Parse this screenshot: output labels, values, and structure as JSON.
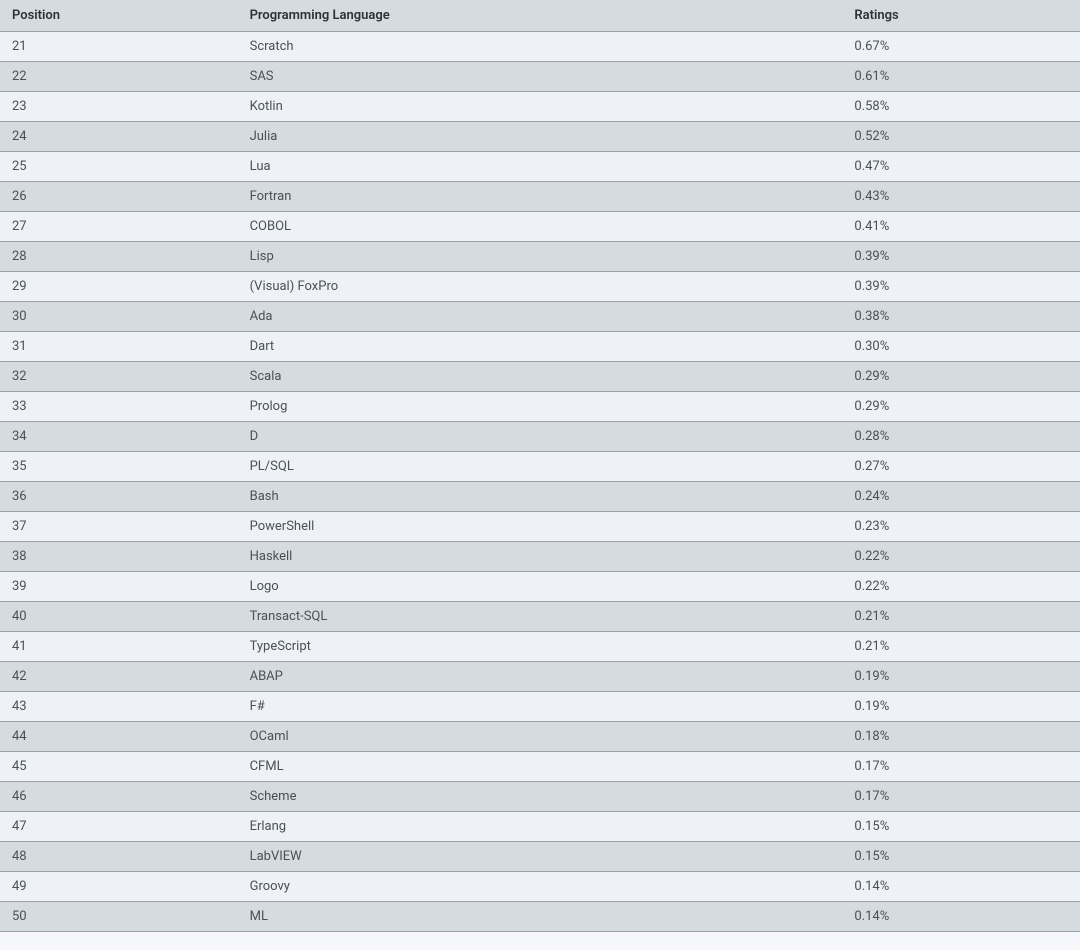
{
  "table": {
    "headers": {
      "position": "Position",
      "language": "Programming Language",
      "ratings": "Ratings"
    },
    "rows": [
      {
        "position": "21",
        "language": "Scratch",
        "ratings": "0.67%"
      },
      {
        "position": "22",
        "language": "SAS",
        "ratings": "0.61%"
      },
      {
        "position": "23",
        "language": "Kotlin",
        "ratings": "0.58%"
      },
      {
        "position": "24",
        "language": "Julia",
        "ratings": "0.52%"
      },
      {
        "position": "25",
        "language": "Lua",
        "ratings": "0.47%"
      },
      {
        "position": "26",
        "language": "Fortran",
        "ratings": "0.43%"
      },
      {
        "position": "27",
        "language": "COBOL",
        "ratings": "0.41%"
      },
      {
        "position": "28",
        "language": "Lisp",
        "ratings": "0.39%"
      },
      {
        "position": "29",
        "language": "(Visual) FoxPro",
        "ratings": "0.39%"
      },
      {
        "position": "30",
        "language": "Ada",
        "ratings": "0.38%"
      },
      {
        "position": "31",
        "language": "Dart",
        "ratings": "0.30%"
      },
      {
        "position": "32",
        "language": "Scala",
        "ratings": "0.29%"
      },
      {
        "position": "33",
        "language": "Prolog",
        "ratings": "0.29%"
      },
      {
        "position": "34",
        "language": "D",
        "ratings": "0.28%"
      },
      {
        "position": "35",
        "language": "PL/SQL",
        "ratings": "0.27%"
      },
      {
        "position": "36",
        "language": "Bash",
        "ratings": "0.24%"
      },
      {
        "position": "37",
        "language": "PowerShell",
        "ratings": "0.23%"
      },
      {
        "position": "38",
        "language": "Haskell",
        "ratings": "0.22%"
      },
      {
        "position": "39",
        "language": "Logo",
        "ratings": "0.22%"
      },
      {
        "position": "40",
        "language": "Transact-SQL",
        "ratings": "0.21%"
      },
      {
        "position": "41",
        "language": "TypeScript",
        "ratings": "0.21%"
      },
      {
        "position": "42",
        "language": "ABAP",
        "ratings": "0.19%"
      },
      {
        "position": "43",
        "language": "F#",
        "ratings": "0.19%"
      },
      {
        "position": "44",
        "language": "OCaml",
        "ratings": "0.18%"
      },
      {
        "position": "45",
        "language": "CFML",
        "ratings": "0.17%"
      },
      {
        "position": "46",
        "language": "Scheme",
        "ratings": "0.17%"
      },
      {
        "position": "47",
        "language": "Erlang",
        "ratings": "0.15%"
      },
      {
        "position": "48",
        "language": "LabVIEW",
        "ratings": "0.15%"
      },
      {
        "position": "49",
        "language": "Groovy",
        "ratings": "0.14%"
      },
      {
        "position": "50",
        "language": "ML",
        "ratings": "0.14%"
      }
    ]
  }
}
